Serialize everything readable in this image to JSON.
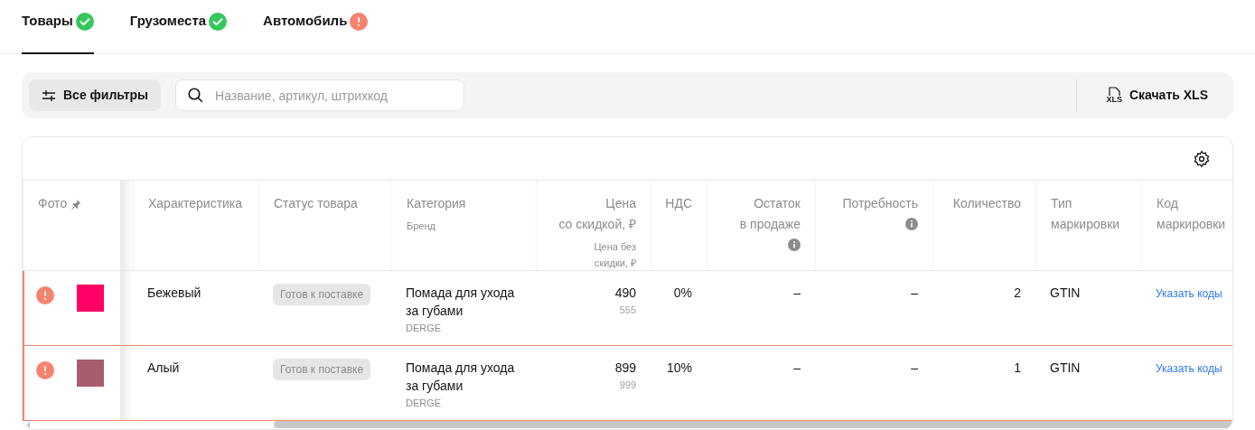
{
  "tabs": [
    {
      "label": "Товары",
      "selected": true,
      "kind": "ok"
    },
    {
      "label": "Грузоместа",
      "selected": false,
      "kind": "ok"
    },
    {
      "label": "Автомобиль",
      "selected": false,
      "kind": "error"
    }
  ],
  "toolbar": {
    "filters_button": "Все фильтры",
    "search": {
      "placeholder": "Название, артикул, штрихкод"
    },
    "download_button": "Скачать XLS",
    "file_icon_label": "XLS"
  },
  "table": {
    "columns": [
      {
        "title": [
          "Фото"
        ],
        "pinned": true
      },
      {
        "title": [
          "Характеристика"
        ]
      },
      {
        "title": [
          "Статус товара"
        ]
      },
      {
        "title": [
          "Категория"
        ],
        "subtitle": [
          "Бренд"
        ]
      },
      {
        "title": [
          "Цена",
          "со скидкой, ₽"
        ],
        "subtitle": [
          "Цена без",
          "скидки, ₽"
        ]
      },
      {
        "title": [
          "НДС"
        ]
      },
      {
        "title": [
          "Остаток",
          "в продаже"
        ],
        "info": true
      },
      {
        "title": [
          "Потребность"
        ],
        "info": true
      },
      {
        "title": [
          "Количество"
        ]
      },
      {
        "title": [
          "Тип",
          "маркировки"
        ]
      },
      {
        "title": [
          "Код",
          "маркировки"
        ]
      }
    ],
    "rows": [
      {
        "kind": "error",
        "color": "#ff0066",
        "feature": "Бежевый",
        "product_status": "Готов к поставке",
        "category": "Помада для ухода за губами",
        "brand": "DERGE",
        "price": "490",
        "old_price": "555",
        "vat": "0%",
        "stock": "–",
        "demand": "–",
        "quantity": "2",
        "marking_type": "GTIN",
        "marking_action": "Указать коды"
      },
      {
        "kind": "error",
        "color": "#a95c6e",
        "feature": "Алый",
        "product_status": "Готов к поставке",
        "category": "Помада для ухода за губами",
        "brand": "DERGE",
        "price": "899",
        "old_price": "999",
        "vat": "10%",
        "stock": "–",
        "demand": "–",
        "quantity": "1",
        "marking_type": "GTIN",
        "marking_action": "Указать коды"
      }
    ]
  }
}
